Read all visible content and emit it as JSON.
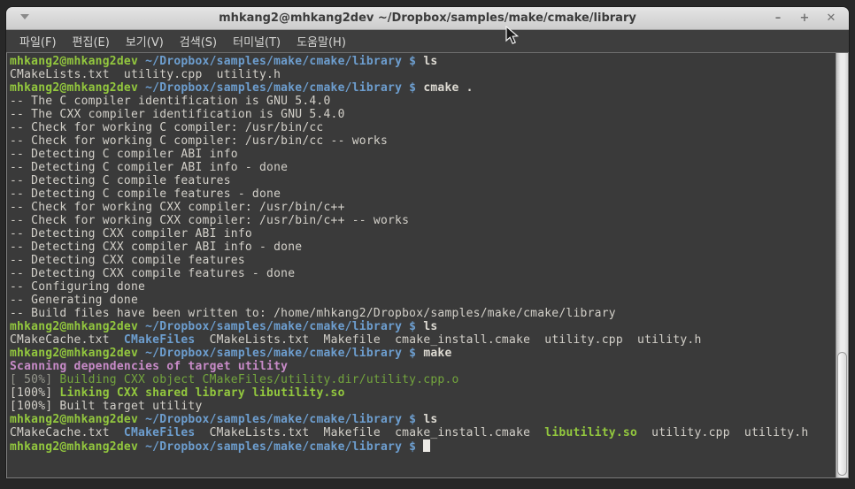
{
  "window": {
    "title": "mhkang2@mhkang2dev ~/Dropbox/samples/make/cmake/library",
    "controls": {
      "minimize": "–",
      "maximize": "+",
      "close": "✕"
    },
    "menu_items": [
      "파일(F)",
      "편집(E)",
      "보기(V)",
      "검색(S)",
      "터미널(T)",
      "도움말(H)"
    ]
  },
  "colors": {
    "terminal_bg": "#3a3a3a",
    "default_fg": "#d3d0c9",
    "prompt_green": "#93c83e",
    "path_blue": "#6d9ecf",
    "magenta": "#c88bc8",
    "dim_green": "#73a53d",
    "dim_gray": "#95968c",
    "titlebar_bg": "#d8d8d8",
    "menubar_bg": "#3e3e3e"
  },
  "terminal": {
    "prompt_user": "mhkang2@mhkang2dev",
    "prompt_path": "~/Dropbox/samples/make/cmake/library",
    "lines": [
      [
        [
          "g",
          "mhkang2@mhkang2dev"
        ],
        [
          "b",
          " ~/Dropbox/samples/make/cmake/library $ "
        ],
        [
          "c",
          "ls"
        ]
      ],
      [
        [
          "w",
          "CMakeLists.txt  utility.cpp  utility.h"
        ]
      ],
      [
        [
          "g",
          "mhkang2@mhkang2dev"
        ],
        [
          "b",
          " ~/Dropbox/samples/make/cmake/library $ "
        ],
        [
          "c",
          "cmake ."
        ]
      ],
      [
        [
          "w",
          "-- The C compiler identification is GNU 5.4.0"
        ]
      ],
      [
        [
          "w",
          "-- The CXX compiler identification is GNU 5.4.0"
        ]
      ],
      [
        [
          "w",
          "-- Check for working C compiler: /usr/bin/cc"
        ]
      ],
      [
        [
          "w",
          "-- Check for working C compiler: /usr/bin/cc -- works"
        ]
      ],
      [
        [
          "w",
          "-- Detecting C compiler ABI info"
        ]
      ],
      [
        [
          "w",
          "-- Detecting C compiler ABI info - done"
        ]
      ],
      [
        [
          "w",
          "-- Detecting C compile features"
        ]
      ],
      [
        [
          "w",
          "-- Detecting C compile features - done"
        ]
      ],
      [
        [
          "w",
          "-- Check for working CXX compiler: /usr/bin/c++"
        ]
      ],
      [
        [
          "w",
          "-- Check for working CXX compiler: /usr/bin/c++ -- works"
        ]
      ],
      [
        [
          "w",
          "-- Detecting CXX compiler ABI info"
        ]
      ],
      [
        [
          "w",
          "-- Detecting CXX compiler ABI info - done"
        ]
      ],
      [
        [
          "w",
          "-- Detecting CXX compile features"
        ]
      ],
      [
        [
          "w",
          "-- Detecting CXX compile features - done"
        ]
      ],
      [
        [
          "w",
          "-- Configuring done"
        ]
      ],
      [
        [
          "w",
          "-- Generating done"
        ]
      ],
      [
        [
          "w",
          "-- Build files have been written to: /home/mhkang2/Dropbox/samples/make/cmake/library"
        ]
      ],
      [
        [
          "g",
          "mhkang2@mhkang2dev"
        ],
        [
          "b",
          " ~/Dropbox/samples/make/cmake/library $ "
        ],
        [
          "c",
          "ls"
        ]
      ],
      [
        [
          "w",
          "CMakeCache.txt  "
        ],
        [
          "b",
          "CMakeFiles"
        ],
        [
          "w",
          "  CMakeLists.txt  Makefile  cmake_install.cmake  utility.cpp  utility.h"
        ]
      ],
      [
        [
          "g",
          "mhkang2@mhkang2dev"
        ],
        [
          "b",
          " ~/Dropbox/samples/make/cmake/library $ "
        ],
        [
          "c",
          "make"
        ]
      ],
      [
        [
          "m",
          "Scanning dependencies of target utility"
        ]
      ],
      [
        [
          "d",
          "[ 50%] "
        ],
        [
          "gn",
          "Building CXX object CMakeFiles/utility.dir/utility.cpp.o"
        ]
      ],
      [
        [
          "w",
          "[100%] "
        ],
        [
          "g",
          "Linking CXX shared library libutility.so"
        ]
      ],
      [
        [
          "w",
          "[100%] Built target utility"
        ]
      ],
      [
        [
          "g",
          "mhkang2@mhkang2dev"
        ],
        [
          "b",
          " ~/Dropbox/samples/make/cmake/library $ "
        ],
        [
          "c",
          "ls"
        ]
      ],
      [
        [
          "w",
          "CMakeCache.txt  "
        ],
        [
          "b",
          "CMakeFiles"
        ],
        [
          "w",
          "  CMakeLists.txt  Makefile  cmake_install.cmake  "
        ],
        [
          "g",
          "libutility.so"
        ],
        [
          "w",
          "  utility.cpp  utility.h"
        ]
      ],
      [
        [
          "g",
          "mhkang2@mhkang2dev"
        ],
        [
          "b",
          " ~/Dropbox/samples/make/cmake/library $ "
        ],
        [
          "cur",
          ""
        ]
      ]
    ]
  }
}
